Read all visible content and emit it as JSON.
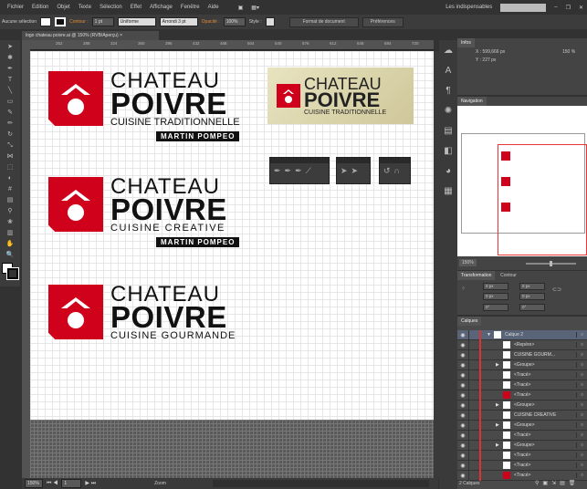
{
  "menu": [
    "Fichier",
    "Edition",
    "Objet",
    "Texte",
    "Sélection",
    "Effet",
    "Affichage",
    "Fenêtre",
    "Aide"
  ],
  "workspace": "Les indispensables",
  "control": {
    "selection": "Aucune sélection",
    "stroke_label": "Contour :",
    "stroke_value": "1 pt",
    "stroke_style": "Uniforme",
    "brush": "Arrondi 3 pt",
    "opacity_label": "Opacité :",
    "opacity_value": "100%",
    "style_label": "Style :",
    "doc_format": "Format de document",
    "prefs": "Préférences"
  },
  "doc_tab": "logo chateau poivre.ai @ 150% (RVB/Aperçu)",
  "ruler": [
    "252",
    "288",
    "324",
    "360",
    "396",
    "432",
    "468",
    "504",
    "540",
    "576",
    "612",
    "648",
    "684",
    "720",
    "756"
  ],
  "logos": [
    {
      "line1": "CHATEAU",
      "line2": "POIVRE",
      "line3": "CUISINE TRADITIONNELLE",
      "badge": "MARTIN POMPEO"
    },
    {
      "line1": "CHATEAU",
      "line2": "POIVRE",
      "line3": "CUISINE CREATIVE",
      "badge": "MARTIN POMPEO"
    },
    {
      "line1": "CHATEAU",
      "line2": "POIVRE",
      "line3": "CUISINE GOURMANDE"
    }
  ],
  "gold_logo": {
    "line1": "CHATEAU",
    "line2": "POIVRE",
    "line3": "CUISINE TRADITIONNELLE"
  },
  "status": {
    "zoom": "150%",
    "page": "1",
    "tool": "Zoom"
  },
  "info": {
    "tab": "Infos",
    "x": "X : 599,666 px",
    "y": "Y : 227 px",
    "zoom": "150 %"
  },
  "navigator": {
    "tab": "Navigation",
    "zoom": "150%"
  },
  "transform": {
    "tab": "Transformation",
    "tab2": "Contour",
    "x": "0 px",
    "y": "0 px",
    "w": "0 px",
    "h": "0 px",
    "angle": "0°",
    "shear": "0°"
  },
  "layers": {
    "tab": "Calques",
    "footer": "2 Calques",
    "items": [
      {
        "name": "Calque 2",
        "level": 0,
        "expand": true,
        "thumb": "#ffffff"
      },
      {
        "name": "<Repère>",
        "level": 1,
        "thumb": "#ffffff"
      },
      {
        "name": "CUISINE GOURM...",
        "level": 1,
        "thumb": "#ffffff"
      },
      {
        "name": "<Groupe>",
        "level": 1,
        "expand": true,
        "thumb": "#ffffff"
      },
      {
        "name": "<Tracé>",
        "level": 1,
        "thumb": "#ffffff"
      },
      {
        "name": "<Tracé>",
        "level": 1,
        "thumb": "#ffffff"
      },
      {
        "name": "<Tracé>",
        "level": 1,
        "thumb": "#d0021b"
      },
      {
        "name": "<Groupe>",
        "level": 1,
        "expand": true,
        "thumb": "#ffffff"
      },
      {
        "name": "CUISINE CREATIVE",
        "level": 1,
        "thumb": "#ffffff"
      },
      {
        "name": "<Groupe>",
        "level": 1,
        "expand": true,
        "thumb": "#ffffff"
      },
      {
        "name": "<Tracé>",
        "level": 1,
        "thumb": "#ffffff"
      },
      {
        "name": "<Groupe>",
        "level": 1,
        "expand": true,
        "thumb": "#ffffff"
      },
      {
        "name": "<Tracé>",
        "level": 1,
        "thumb": "#ffffff"
      },
      {
        "name": "<Tracé>",
        "level": 1,
        "thumb": "#ffffff"
      },
      {
        "name": "<Tracé>",
        "level": 1,
        "thumb": "#d0021b"
      }
    ]
  }
}
